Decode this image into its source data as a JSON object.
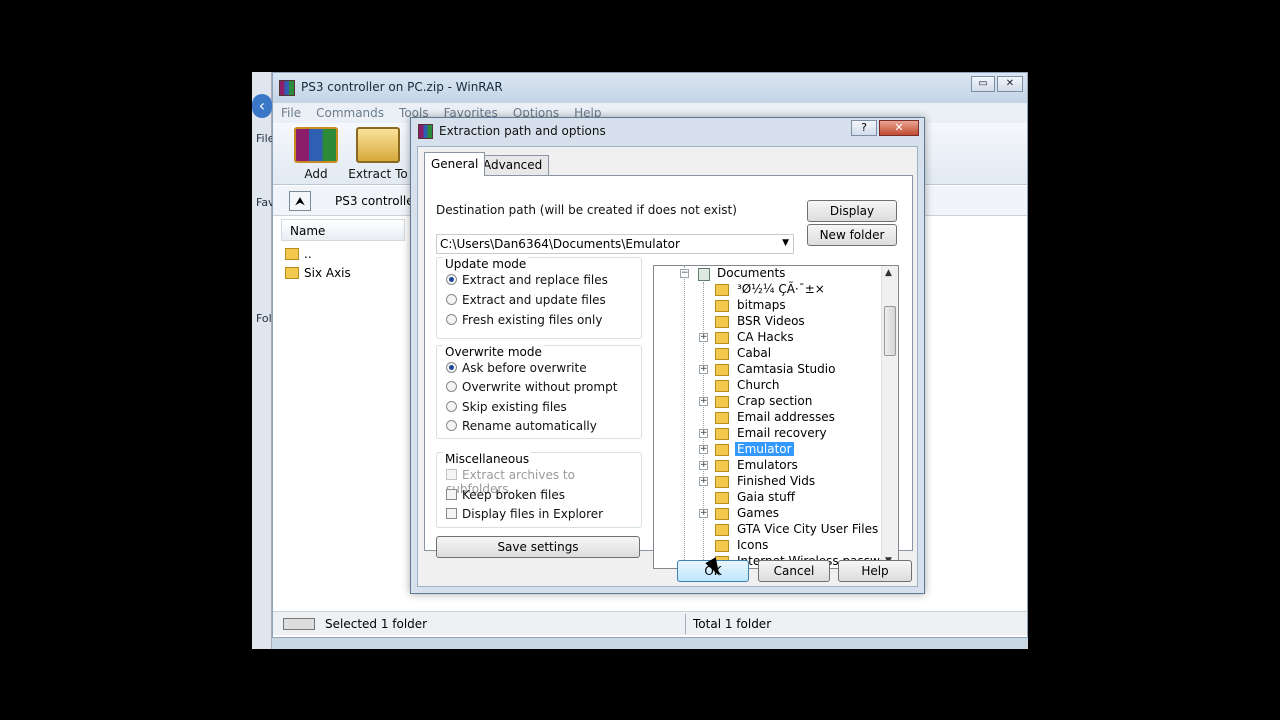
{
  "winrar": {
    "title": "PS3 controller on PC.zip - WinRAR",
    "menu": [
      "File",
      "Commands",
      "Tools",
      "Favorites",
      "Options",
      "Help"
    ],
    "toolbar": {
      "add": "Add",
      "extract_to": "Extract To"
    },
    "address": "PS3 controller",
    "column_name": "Name",
    "files": [
      "..",
      "Six Axis"
    ],
    "status_left": "Selected 1 folder",
    "status_right": "Total 1 folder"
  },
  "explorer_bg": {
    "file": "File",
    "fav": "Fav",
    "fold": "Fol"
  },
  "dialog": {
    "title": "Extraction path and options",
    "help_glyph": "?",
    "close_glyph": "✕",
    "tabs": [
      "General",
      "Advanced"
    ],
    "dest_label": "Destination path (will be created if does not exist)",
    "dest_path": "C:\\Users\\Dan6364\\Documents\\Emulator",
    "display_btn": "Display",
    "new_folder_btn": "New folder",
    "update_mode": {
      "title": "Update mode",
      "options": [
        "Extract and replace files",
        "Extract and update files",
        "Fresh existing files only"
      ],
      "selected": 0
    },
    "overwrite_mode": {
      "title": "Overwrite mode",
      "options": [
        "Ask before overwrite",
        "Overwrite without prompt",
        "Skip existing files",
        "Rename automatically"
      ],
      "selected": 0
    },
    "misc": {
      "title": "Miscellaneous",
      "options": [
        "Extract archives to subfolders",
        "Keep broken files",
        "Display files in Explorer"
      ]
    },
    "save_settings_btn": "Save settings",
    "tree": {
      "root": "Documents",
      "items": [
        {
          "name": "³Ø½¼ ÇÃ·¯±×",
          "exp": false
        },
        {
          "name": "bitmaps",
          "exp": false
        },
        {
          "name": "BSR Videos",
          "exp": false
        },
        {
          "name": "CA Hacks",
          "exp": true
        },
        {
          "name": "Cabal",
          "exp": false
        },
        {
          "name": "Camtasia Studio",
          "exp": true
        },
        {
          "name": "Church",
          "exp": false
        },
        {
          "name": "Crap section",
          "exp": true
        },
        {
          "name": "Email addresses",
          "exp": false
        },
        {
          "name": "Email recovery",
          "exp": true
        },
        {
          "name": "Emulator",
          "exp": true,
          "sel": true
        },
        {
          "name": "Emulators",
          "exp": true
        },
        {
          "name": "Finished Vids",
          "exp": true
        },
        {
          "name": "Gaia stuff",
          "exp": false
        },
        {
          "name": "Games",
          "exp": true
        },
        {
          "name": "GTA Vice City User Files",
          "exp": false
        },
        {
          "name": "Icons",
          "exp": false
        },
        {
          "name": "Internet Wireless password(s)",
          "exp": false
        }
      ]
    },
    "ok_btn": "OK",
    "cancel_btn": "Cancel",
    "help_btn": "Help"
  }
}
